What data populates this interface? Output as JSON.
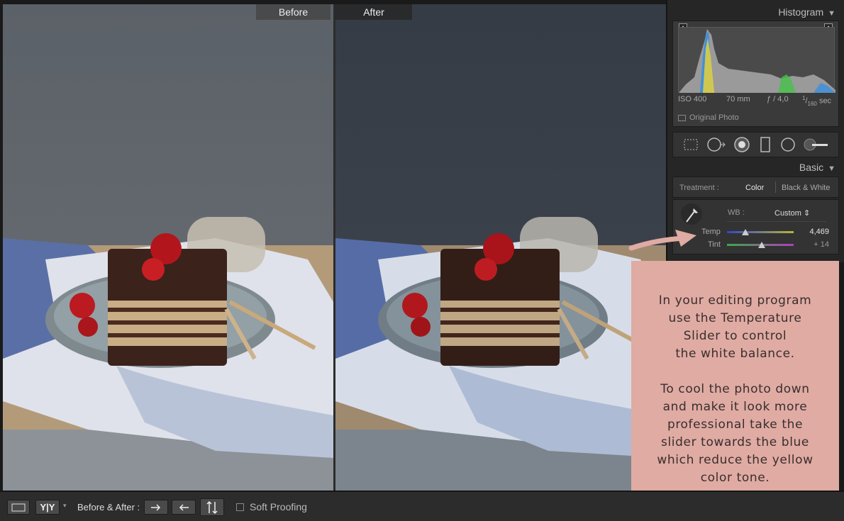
{
  "compare": {
    "before_label": "Before",
    "after_label": "After"
  },
  "histogram": {
    "title": "Histogram",
    "iso": "ISO 400",
    "focal": "70 mm",
    "aperture": "ƒ / 4,0",
    "shutter_num": "1",
    "shutter_den": "160",
    "shutter_unit": "sec",
    "original_photo": "Original Photo"
  },
  "tools": [
    "crop-tool",
    "spot-removal-tool",
    "red-eye-tool",
    "graduated-filter-tool",
    "radial-filter-tool",
    "adjustment-brush-tool"
  ],
  "basic": {
    "title": "Basic",
    "treatment_label": "Treatment :",
    "color_option": "Color",
    "bw_option": "Black & White",
    "wb_label": "WB :",
    "wb_value": "Custom",
    "temp_label": "Temp",
    "temp_value": "4,469",
    "temp_level": 0.28,
    "tint_label": "Tint",
    "tint_value": "+ 14",
    "tint_level": 0.52
  },
  "toolbar": {
    "compare_label": "Before & After :",
    "yy_label": "Y|Y",
    "soft_proofing": "Soft Proofing"
  },
  "note": {
    "paragraph1": [
      "In your editing program",
      "use the Temperature",
      "Slider to control",
      "the white balance."
    ],
    "paragraph2": [
      "To cool the photo down",
      "and make it look more",
      "professional take the",
      "slider towards the blue",
      "which reduce the yellow",
      "color tone."
    ]
  },
  "colors": {
    "note_bg": "#dfaba3",
    "panel_bg": "#262626",
    "arrow": "#dfaba3"
  }
}
